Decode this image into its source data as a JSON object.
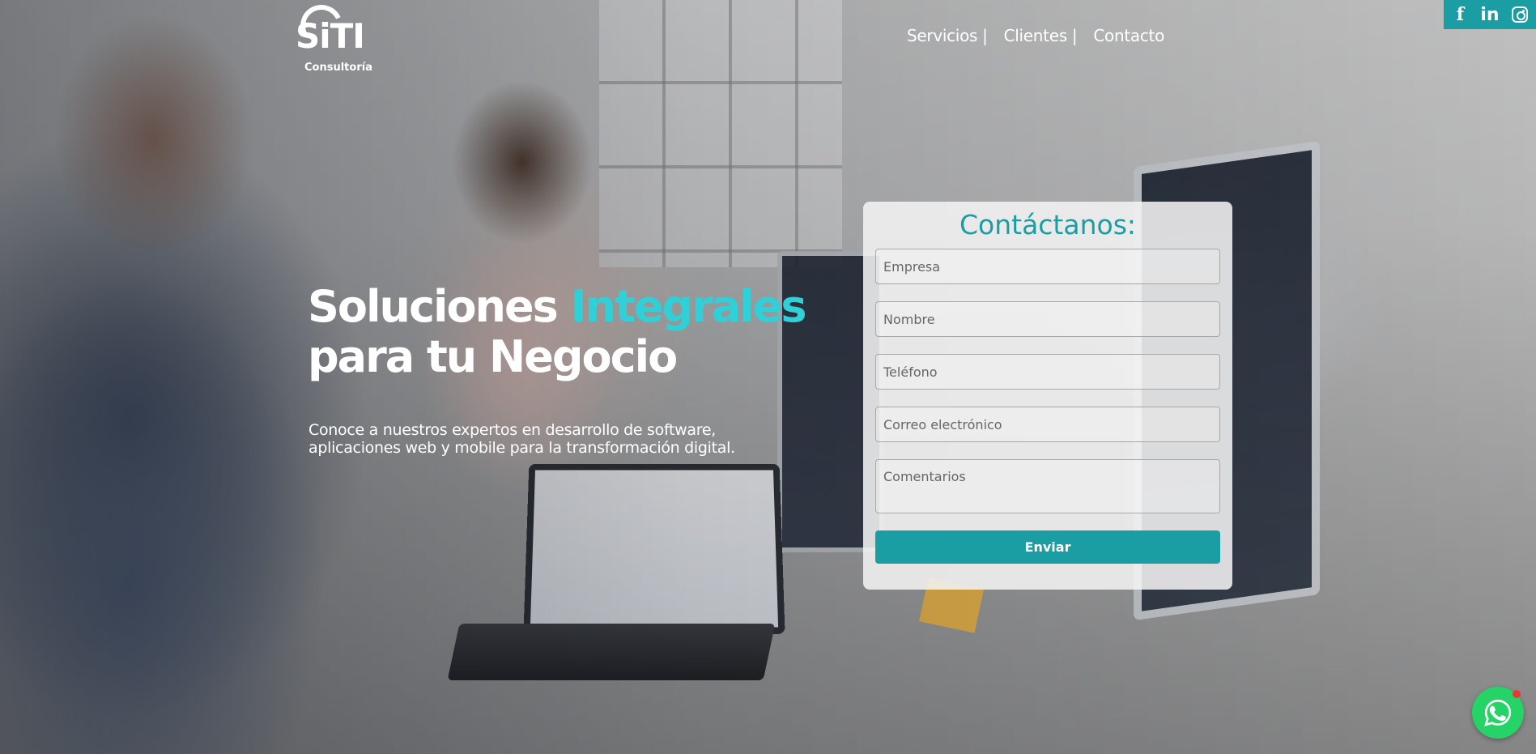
{
  "brand": {
    "logo_word": "SiTI",
    "logo_sub": "Consultoría"
  },
  "nav": {
    "items": [
      {
        "label": "Servicios |"
      },
      {
        "label": "Clientes |"
      },
      {
        "label": "Contacto"
      }
    ]
  },
  "social": {
    "facebook": "f",
    "linkedin": "in",
    "accent_color": "#1a9ea3"
  },
  "hero": {
    "headline_part1": "Soluciones ",
    "headline_accent": "Integrales",
    "headline_line2": "para tu Negocio",
    "subtext": "Conoce a nuestros expertos en desarrollo de software, aplicaciones web y mobile para la transformación digital.",
    "accent_color": "#2fd0d8"
  },
  "form": {
    "title": "Contáctanos:",
    "fields": {
      "empresa_placeholder": "Empresa",
      "nombre_placeholder": "Nombre",
      "telefono_placeholder": "Teléfono",
      "correo_placeholder": "Correo electrónico",
      "comentarios_placeholder": "Comentarios"
    },
    "submit_label": "Enviar"
  },
  "icons": {
    "facebook": "facebook-icon",
    "linkedin": "linkedin-icon",
    "instagram": "instagram-icon",
    "whatsapp": "whatsapp-icon"
  }
}
